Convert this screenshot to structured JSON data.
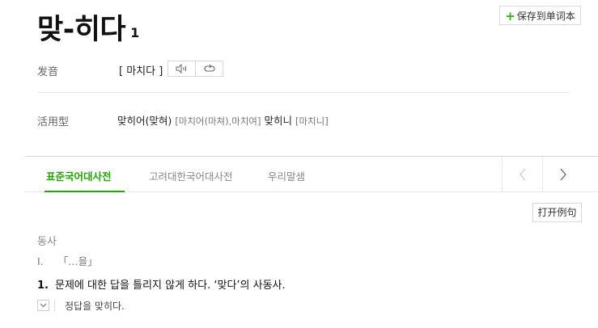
{
  "entry": {
    "headword": "맞-히다",
    "homograph": "1",
    "save_label": "保存到单词本"
  },
  "pronunciation": {
    "label": "发音",
    "text": "[ 마치다 ]"
  },
  "conjugation": {
    "label": "活用型",
    "items": [
      {
        "word": "맞히어(맞혀)",
        "pron": "[마치어(마쳐),마치여]"
      },
      {
        "word": "맞히니",
        "pron": "[마치니]"
      }
    ]
  },
  "tabs": [
    {
      "label": "표준국어대사전",
      "active": true
    },
    {
      "label": "고려대한국어대사전",
      "active": false
    },
    {
      "label": "우리말샘",
      "active": false
    }
  ],
  "example_button": "打开例句",
  "definition": {
    "pos": "동사",
    "sense_marker": "I.",
    "sense_pattern": "「…을」",
    "number": "1.",
    "text": "문제에 대한 답을 틀리지 않게 하다. ‘맞다’의 사동사.",
    "example": "정답을 맞히다."
  },
  "colors": {
    "accent": "#1ea800",
    "text": "#222222",
    "muted": "#888888"
  }
}
